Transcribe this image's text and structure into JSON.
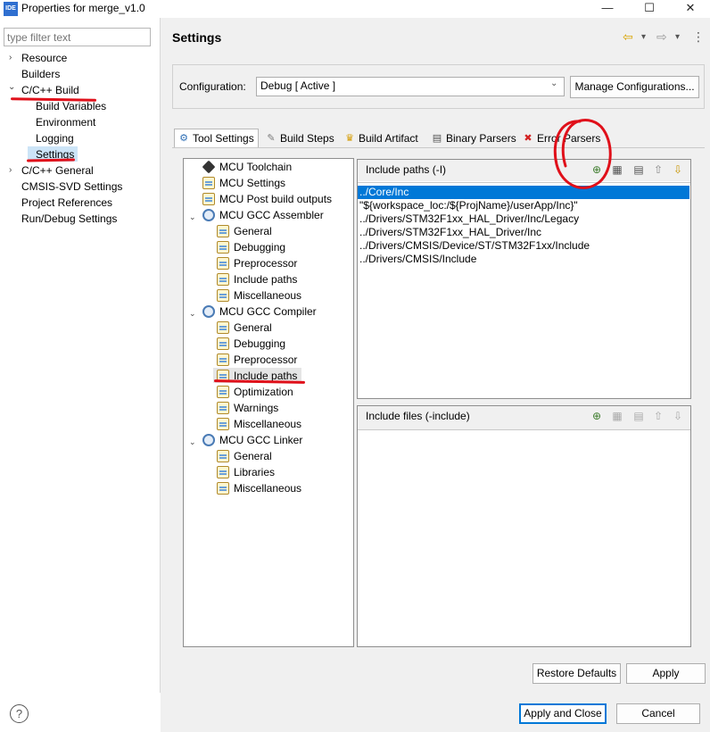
{
  "window": {
    "app_icon_text": "IDE",
    "title": "Properties for merge_v1.0",
    "minimize": "—",
    "maximize": "☐",
    "close": "✕"
  },
  "left": {
    "filter_placeholder": "type filter text",
    "items": [
      {
        "label": "Resource",
        "expander": "›"
      },
      {
        "label": "Builders",
        "expander": ""
      },
      {
        "label": "C/C++ Build",
        "expander": "⌄"
      },
      {
        "label": "Build Variables",
        "expander": ""
      },
      {
        "label": "Environment",
        "expander": ""
      },
      {
        "label": "Logging",
        "expander": ""
      },
      {
        "label": "Settings",
        "expander": ""
      },
      {
        "label": "C/C++ General",
        "expander": "›"
      },
      {
        "label": "CMSIS-SVD Settings",
        "expander": ""
      },
      {
        "label": "Project References",
        "expander": ""
      },
      {
        "label": "Run/Debug Settings",
        "expander": ""
      }
    ]
  },
  "header": {
    "title": "Settings",
    "back_icon": "⇦",
    "forward_icon": "⇨",
    "dropdown_icon": "▾",
    "menu_icon": "⋮"
  },
  "configuration": {
    "label": "Configuration:",
    "value": "Debug  [ Active ]",
    "manage_button": "Manage Configurations..."
  },
  "tabs": [
    {
      "label": "Tool Settings",
      "icon": "gear-icon",
      "glyph": "⚙"
    },
    {
      "label": "Build Steps",
      "icon": "hammer-icon",
      "glyph": "✎"
    },
    {
      "label": "Build Artifact",
      "icon": "trophy-icon",
      "glyph": "♛"
    },
    {
      "label": "Binary Parsers",
      "icon": "binary-icon",
      "glyph": "▤"
    },
    {
      "label": "Error Parsers",
      "icon": "error-icon",
      "glyph": "✖"
    }
  ],
  "tool_tree": [
    {
      "label": "MCU Toolchain",
      "icon": "chip"
    },
    {
      "label": "MCU Settings",
      "icon": "page"
    },
    {
      "label": "MCU Post build outputs",
      "icon": "page"
    },
    {
      "label": "MCU GCC Assembler",
      "icon": "gear",
      "expander": "⌄"
    },
    {
      "label": "General",
      "icon": "page"
    },
    {
      "label": "Debugging",
      "icon": "page"
    },
    {
      "label": "Preprocessor",
      "icon": "page"
    },
    {
      "label": "Include paths",
      "icon": "page"
    },
    {
      "label": "Miscellaneous",
      "icon": "page"
    },
    {
      "label": "MCU GCC Compiler",
      "icon": "gear",
      "expander": "⌄"
    },
    {
      "label": "General",
      "icon": "page"
    },
    {
      "label": "Debugging",
      "icon": "page"
    },
    {
      "label": "Preprocessor",
      "icon": "page"
    },
    {
      "label": "Include paths",
      "icon": "page"
    },
    {
      "label": "Optimization",
      "icon": "page"
    },
    {
      "label": "Warnings",
      "icon": "page"
    },
    {
      "label": "Miscellaneous",
      "icon": "page"
    },
    {
      "label": "MCU GCC Linker",
      "icon": "gear",
      "expander": "⌄"
    },
    {
      "label": "General",
      "icon": "page"
    },
    {
      "label": "Libraries",
      "icon": "page"
    },
    {
      "label": "Miscellaneous",
      "icon": "page"
    }
  ],
  "include_paths": {
    "title": "Include paths (-I)",
    "rows": [
      "../Core/Inc",
      "\"${workspace_loc:/${ProjName}/userApp/Inc}\"",
      "../Drivers/STM32F1xx_HAL_Driver/Inc/Legacy",
      "../Drivers/STM32F1xx_HAL_Driver/Inc",
      "../Drivers/CMSIS/Device/ST/STM32F1xx/Include",
      "../Drivers/CMSIS/Include"
    ],
    "tools": [
      "add-icon",
      "delete-icon",
      "edit-icon",
      "move-up-icon",
      "move-down-icon"
    ]
  },
  "include_files": {
    "title": "Include files (-include)",
    "rows": []
  },
  "buttons": {
    "restore_defaults": "Restore Defaults",
    "apply": "Apply",
    "apply_and_close": "Apply and Close",
    "cancel": "Cancel",
    "help": "?"
  },
  "colors": {
    "selection": "#0078d7",
    "annotation": "#e0101a"
  }
}
